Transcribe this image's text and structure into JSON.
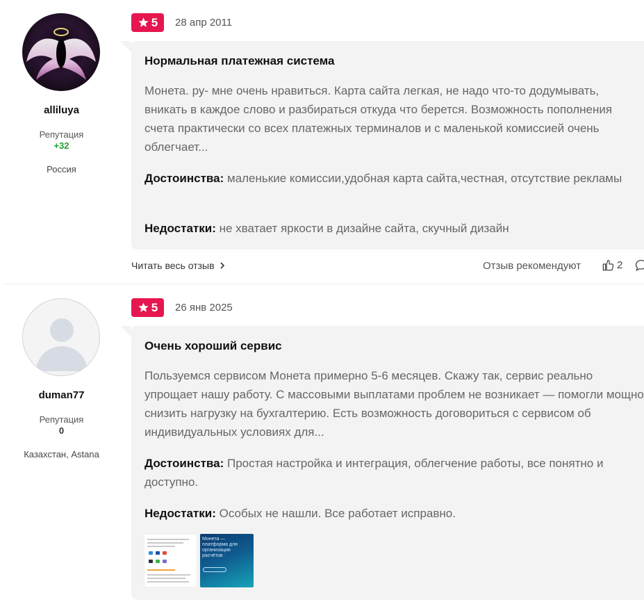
{
  "reviews": [
    {
      "user": {
        "name": "alliluya",
        "reputation_label": "Репутация",
        "reputation": "+32",
        "location": "Россия"
      },
      "rating": "5",
      "date": "28 апр 2011",
      "title": "Нормальная платежная система",
      "text": "Монета. ру- мне очень нравиться. Карта сайта легкая, не надо что-то додумывать, вникать в каждое слово и разбираться откуда что берется. Возможность пополнения счета практически со всех платежных терминалов и с маленькой комиссией очень облегчает...",
      "pros_label": "Достоинства:",
      "pros": "маленькие комиссии,удобная карта сайта,честная, отсутствие рекламы",
      "cons_label": "Недостатки:",
      "cons": "не хватает яркости в дизайне сайта, скучный дизайн",
      "read_more": "Читать весь отзыв",
      "recommend_label": "Отзыв рекомендуют",
      "likes": "2"
    },
    {
      "user": {
        "name": "duman77",
        "reputation_label": "Репутация",
        "reputation": "0",
        "location": "Казахстан, Astana"
      },
      "rating": "5",
      "date": "26 янв 2025",
      "title": "Очень хороший сервис",
      "text": "Пользуемся сервисом Монета примерно 5-6 месяцев. Скажу так, сервис реально упрощает нашу работу. С массовыми выплатами проблем не возникает — помогли мощно снизить нагрузку на бухгалтерию. Есть возможность договориться с сервисом об индивидуальных условиях для...",
      "pros_label": "Достоинства:",
      "pros": "Простая настройка и интеграция, облегчение работы, все понятно и доступно.",
      "cons_label": "Недостатки:",
      "cons": "Особых не нашли. Все работает исправно.",
      "thumbnail_text": "Монета — платформа для организации расчётов"
    }
  ],
  "colors": {
    "badge": "#e6164f",
    "positive": "#21a038",
    "bubble": "#f3f3f3"
  },
  "icons": {
    "rating": "star-icon",
    "read_more": "chevron-right-icon",
    "like": "thumbs-up-icon",
    "comment": "comment-icon"
  }
}
